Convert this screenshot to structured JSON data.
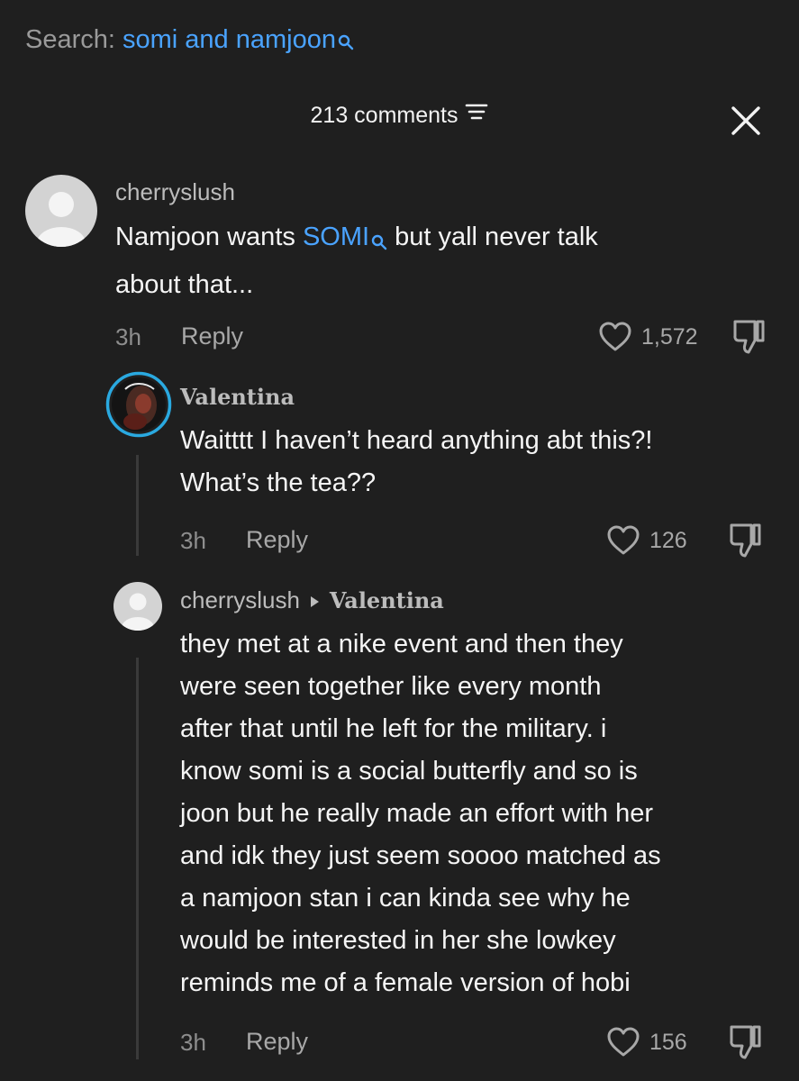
{
  "search": {
    "prefix": "Search:",
    "query": "somi and namjoon"
  },
  "header": {
    "comments_count": "213 comments"
  },
  "comments": [
    {
      "username": "cherryslush",
      "text_before": "Namjoon wants ",
      "link": "SOMI",
      "text_line1_after": " but yall never talk",
      "text_line2": "about that...",
      "time": "3h",
      "reply_label": "Reply",
      "likes": "1,572"
    },
    {
      "username": "Valentina",
      "text_line1": "Waitttt I haven’t heard anything abt this?!",
      "text_line2": "What’s the tea??",
      "time": "3h",
      "reply_label": "Reply",
      "likes": "126"
    },
    {
      "username": "cherryslush",
      "reply_to": "Valentina",
      "lines": [
        "they met at a nike event and then they",
        "were seen together like every month",
        "after that until he left for the military. i",
        "know somi is a social butterfly and so is",
        "joon but he really made an effort with her",
        "and idk they just seem soooo matched as",
        "a namjoon stan i can kinda see why he",
        "would be interested in her she lowkey",
        "reminds me of a female version of hobi"
      ],
      "time": "3h",
      "reply_label": "Reply",
      "likes": "156"
    }
  ],
  "colors": {
    "background": "#1f1f1f",
    "link": "#4aa3ff",
    "story_ring": "#2aa9e0"
  },
  "icons": [
    "search-icon",
    "filter-icon",
    "close-icon",
    "heart-icon",
    "dislike-icon",
    "triangle-right-icon"
  ]
}
